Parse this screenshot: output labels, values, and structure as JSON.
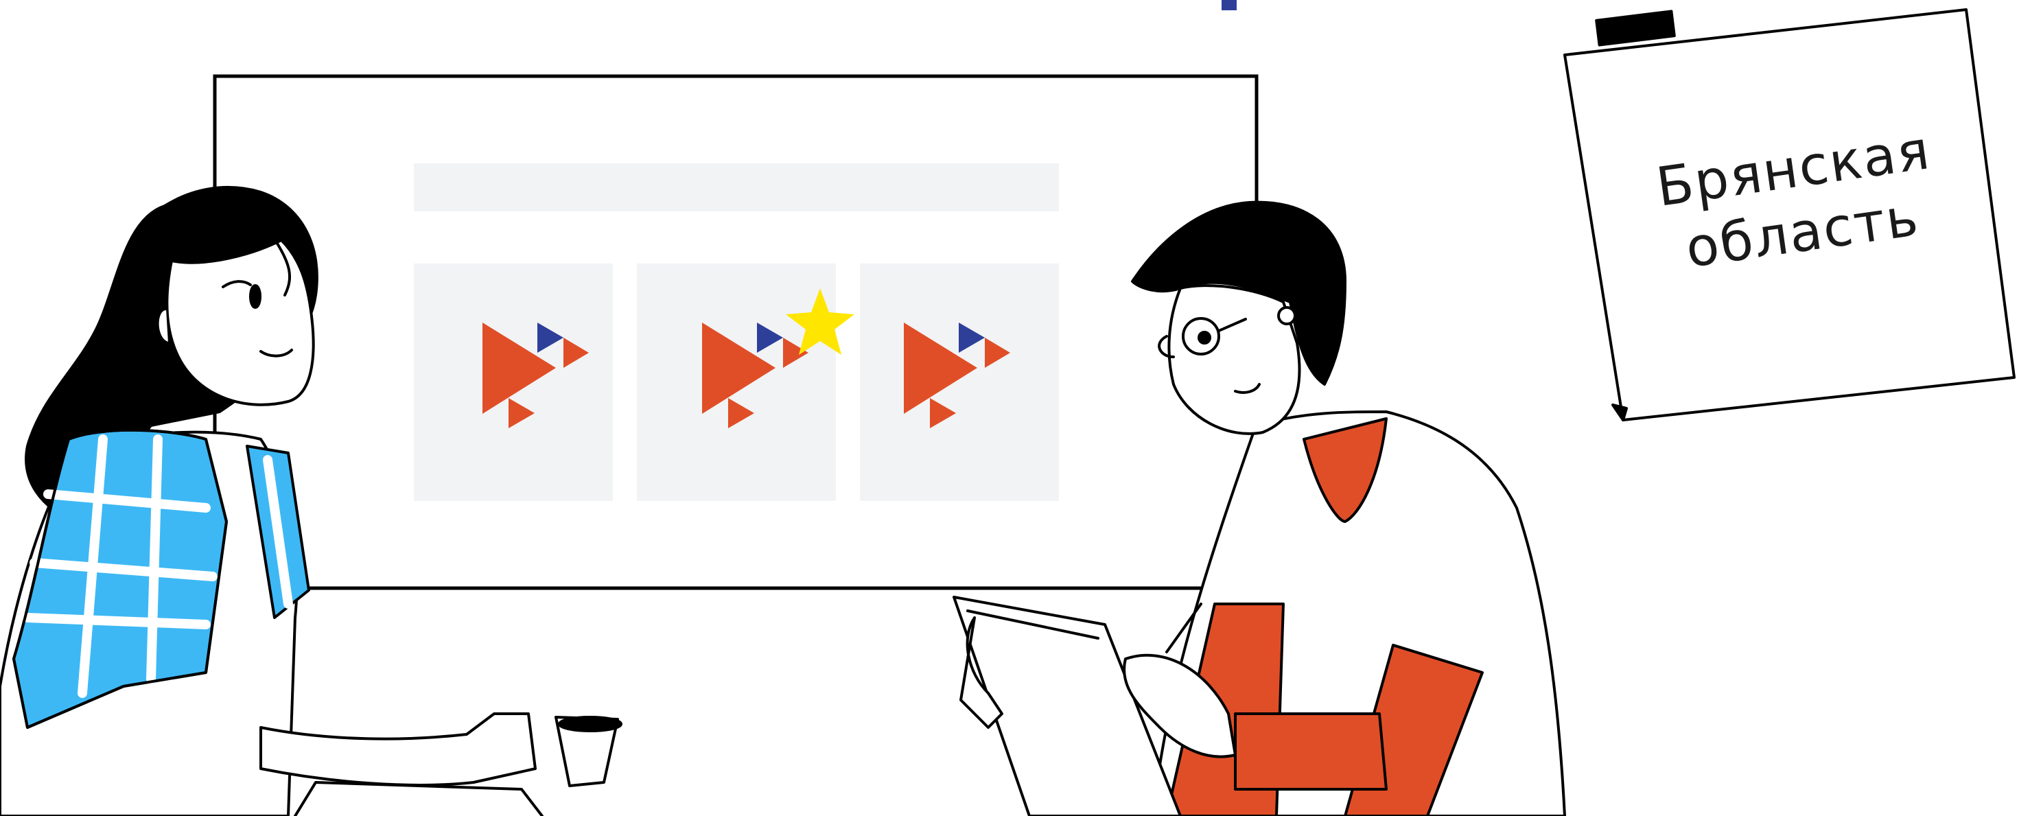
{
  "note": {
    "line1": "Брянская",
    "line2": "область"
  },
  "colors": {
    "accent_orange": "#e04e27",
    "accent_blue": "#2e3f9a",
    "scarf_blue": "#3db8f5",
    "star_yellow": "#ffe600",
    "panel_grey": "#f2f3f5",
    "ink": "#000000"
  },
  "board": {
    "tiles": [
      {
        "icon": "play-logo-icon",
        "starred": false
      },
      {
        "icon": "play-logo-icon",
        "starred": true
      },
      {
        "icon": "play-logo-icon",
        "starred": false
      }
    ]
  }
}
